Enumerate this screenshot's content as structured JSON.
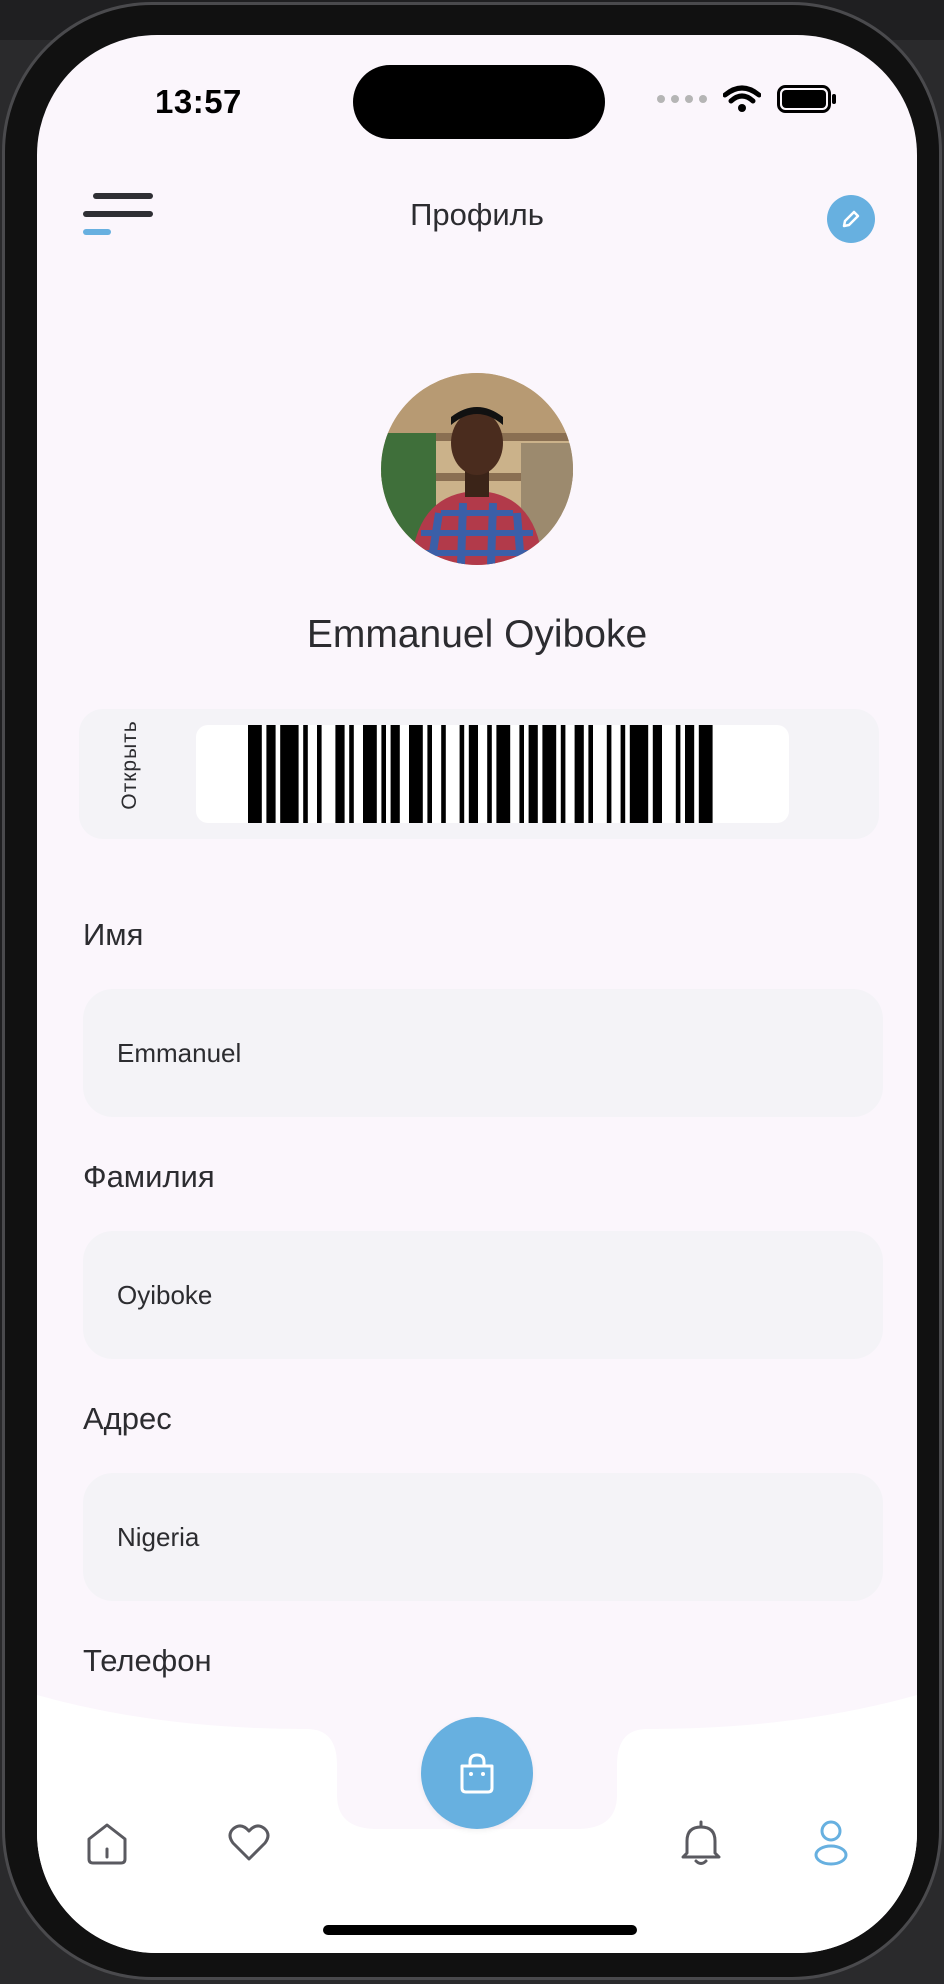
{
  "status": {
    "time": "13:57"
  },
  "header": {
    "title": "Профиль"
  },
  "profile": {
    "name": "Emmanuel Oyiboke"
  },
  "card": {
    "open_label": "Открыть"
  },
  "fields": [
    {
      "label": "Имя",
      "value": "Emmanuel"
    },
    {
      "label": "Фамилия",
      "value": "Oyiboke"
    },
    {
      "label": "Адрес",
      "value": "Nigeria"
    },
    {
      "label": "Телефон",
      "value": ""
    }
  ],
  "nav": {
    "items": [
      "home-icon",
      "heart-icon",
      "bag-icon",
      "bell-icon",
      "user-icon"
    ],
    "active": "user-icon"
  },
  "colors": {
    "accent": "#67b0e0",
    "screen_bg": "#fbf6fc",
    "field_bg": "#f4f3f7",
    "text": "#2c2c30"
  }
}
